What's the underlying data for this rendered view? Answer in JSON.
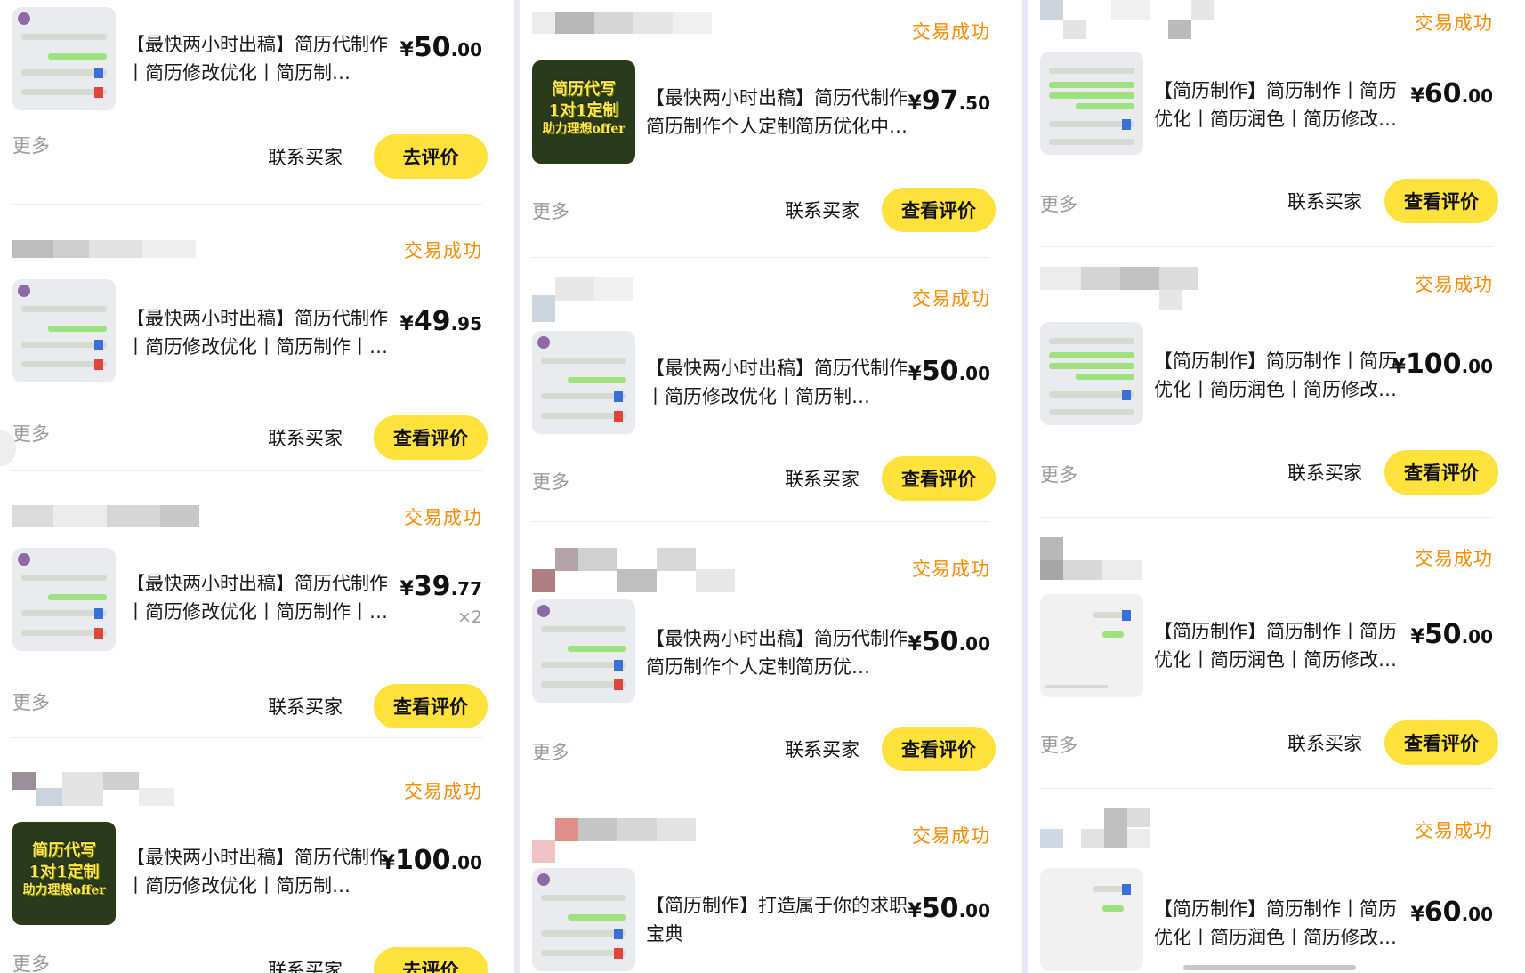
{
  "colors": {
    "status": "#ff8a00",
    "button_primary": "#ffe33c",
    "thumb_bubble_green": "#9de27f"
  },
  "labels": {
    "status": "交易成功",
    "more": "更多",
    "contact": "联系买家",
    "go_review": "去评价",
    "view_review": "查看评价"
  },
  "columns": [
    {
      "orders": [
        {
          "status": "",
          "title": "【最快两小时出稿】简历代制作丨简历修改优化丨简历制…",
          "price_int": "50",
          "price_dec": ".00",
          "qty": "",
          "thumb": "chat",
          "action": "去评价"
        },
        {
          "status": "交易成功",
          "title": "【最快两小时出稿】简历代制作丨简历修改优化丨简历制作丨…",
          "price_int": "49",
          "price_dec": ".95",
          "qty": "",
          "thumb": "chat",
          "action": "查看评价"
        },
        {
          "status": "交易成功",
          "title": "【最快两小时出稿】简历代制作丨简历修改优化丨简历制作丨…",
          "price_int": "39",
          "price_dec": ".77",
          "qty": "×2",
          "thumb": "chat",
          "action": "查看评价"
        },
        {
          "status": "交易成功",
          "title": "【最快两小时出稿】简历代制作丨简历修改优化丨简历制…",
          "price_int": "100",
          "price_dec": ".00",
          "qty": "",
          "thumb": "poster",
          "action": "去评价"
        }
      ]
    },
    {
      "orders": [
        {
          "status": "交易成功",
          "title": "【最快两小时出稿】简历代制作简历制作个人定制简历优化中…",
          "price_int": "97",
          "price_dec": ".50",
          "qty": "",
          "thumb": "poster",
          "action": "查看评价"
        },
        {
          "status": "交易成功",
          "title": "【最快两小时出稿】简历代制作丨简历修改优化丨简历制…",
          "price_int": "50",
          "price_dec": ".00",
          "qty": "",
          "thumb": "chat",
          "action": "查看评价"
        },
        {
          "status": "交易成功",
          "title": "【最快两小时出稿】简历代制作简历制作个人定制简历优…",
          "price_int": "50",
          "price_dec": ".00",
          "qty": "",
          "thumb": "chat",
          "action": "查看评价"
        },
        {
          "status": "交易成功",
          "title": "【简历制作】打造属于你的求职宝典",
          "price_int": "50",
          "price_dec": ".00",
          "qty": "",
          "thumb": "chat",
          "action": ""
        }
      ]
    },
    {
      "orders": [
        {
          "status": "交易成功",
          "title": "【简历制作】简历制作丨简历优化丨简历润色丨简历修改…",
          "price_int": "60",
          "price_dec": ".00",
          "qty": "",
          "thumb": "chat",
          "action": "查看评价"
        },
        {
          "status": "交易成功",
          "title": "【简历制作】简历制作丨简历优化丨简历润色丨简历修改…",
          "price_int": "100",
          "price_dec": ".00",
          "qty": "",
          "thumb": "chat",
          "action": "查看评价"
        },
        {
          "status": "交易成功",
          "title": "【简历制作】简历制作丨简历优化丨简历润色丨简历修改…",
          "price_int": "50",
          "price_dec": ".00",
          "qty": "",
          "thumb": "plain",
          "action": "查看评价"
        },
        {
          "status": "交易成功",
          "title": "【简历制作】简历制作丨简历优化丨简历润色丨简历修改…",
          "price_int": "60",
          "price_dec": ".00",
          "qty": "",
          "thumb": "plain",
          "action": ""
        }
      ]
    }
  ],
  "poster_text": [
    "简历代写",
    "1对1定制",
    "助力理想offer"
  ],
  "currency": "¥"
}
